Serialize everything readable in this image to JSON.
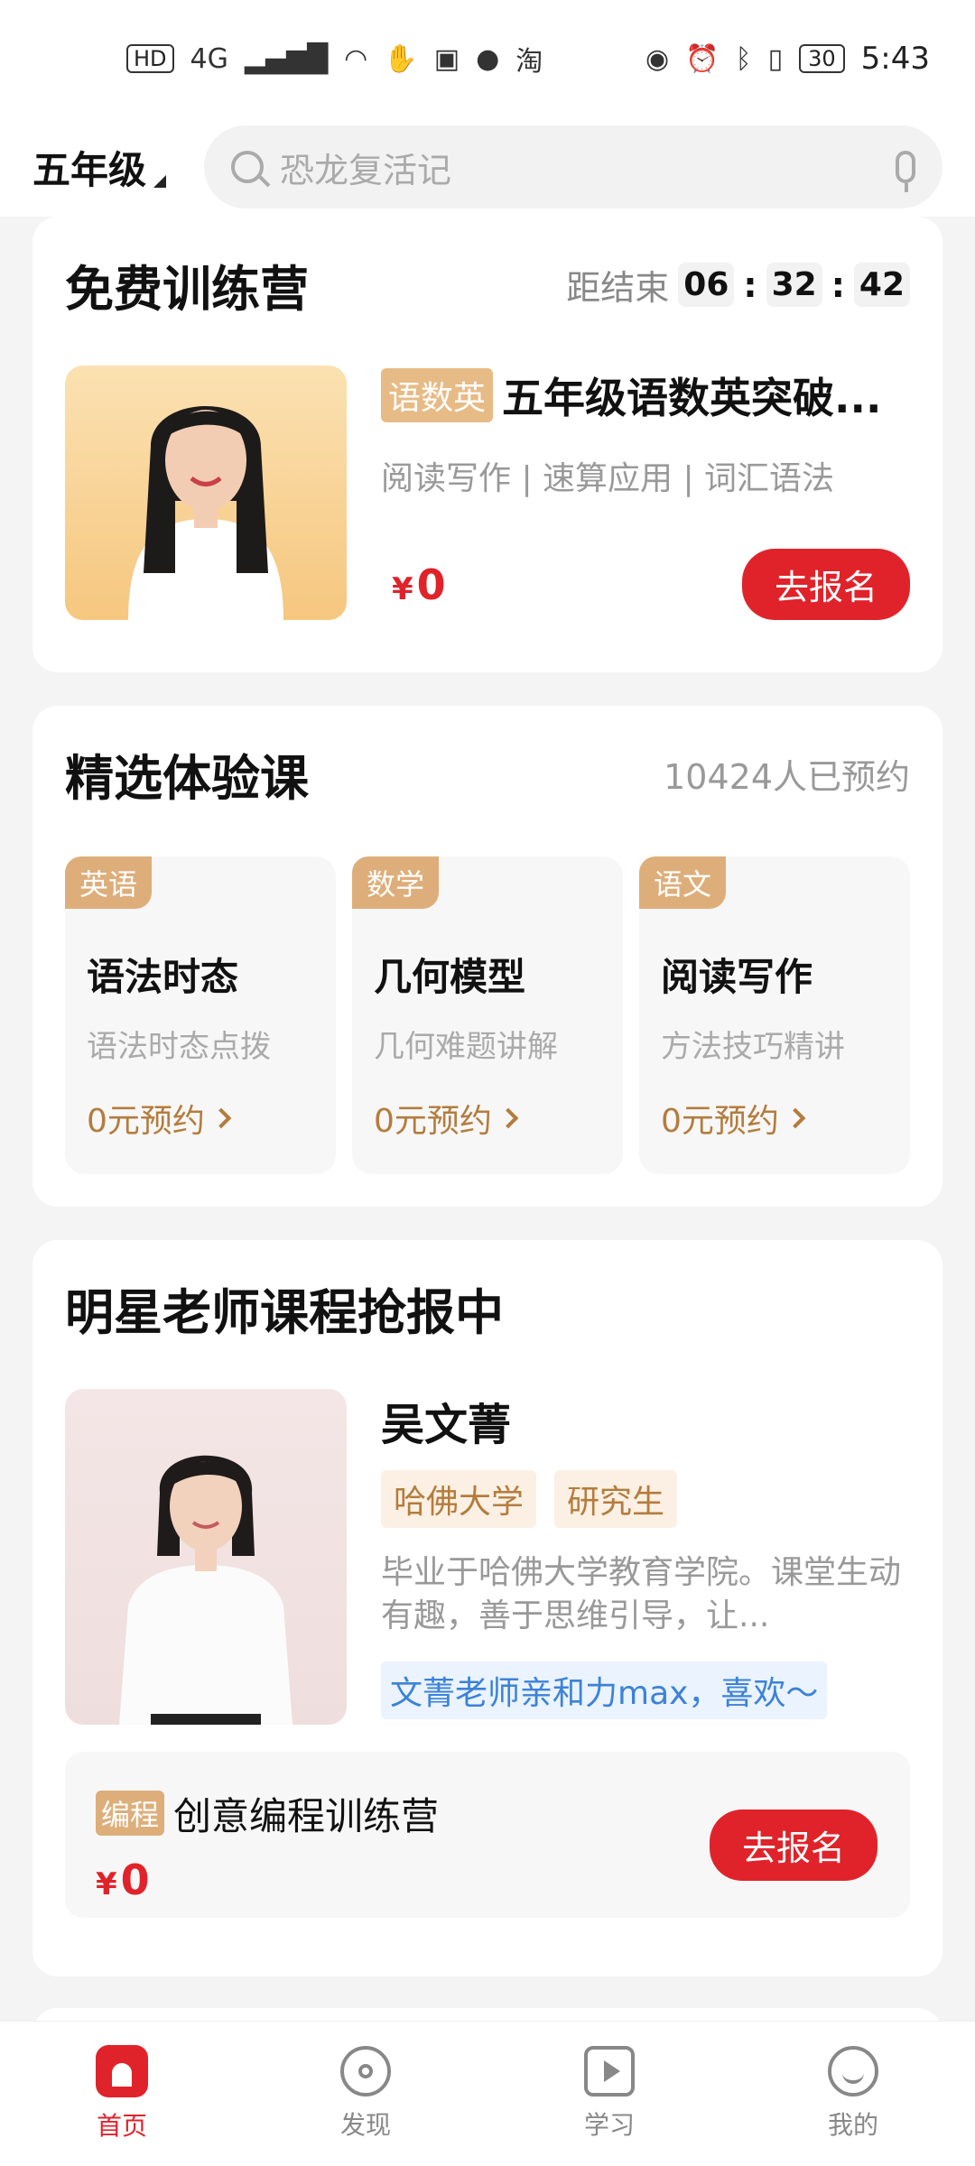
{
  "status": {
    "time": "5:43",
    "battery": "30",
    "left_icons": [
      "HD",
      "4G",
      "signal",
      "wifi",
      "hand",
      "app",
      "message",
      "淘"
    ],
    "right_icons": [
      "eye",
      "alarm",
      "bluetooth",
      "vibrate"
    ]
  },
  "header": {
    "grade": "五年级",
    "search_placeholder": "恐龙复活记"
  },
  "free_camp": {
    "title": "免费训练营",
    "countdown_label": "距结束",
    "countdown": [
      "06",
      "32",
      "42"
    ],
    "course": {
      "tag": "语数英",
      "title": "五年级语数英突破...",
      "subtitle": "阅读写作 | 速算应用 | 词汇语法",
      "price_symbol": "¥",
      "price": "0",
      "cta": "去报名"
    }
  },
  "trial": {
    "title": "精选体验课",
    "count": "10424人已预约",
    "items": [
      {
        "tag": "英语",
        "title": "语法时态",
        "subtitle": "语法时态点拨",
        "cta": "0元预约"
      },
      {
        "tag": "数学",
        "title": "几何模型",
        "subtitle": "几何难题讲解",
        "cta": "0元预约"
      },
      {
        "tag": "语文",
        "title": "阅读写作",
        "subtitle": "方法技巧精讲",
        "cta": "0元预约"
      }
    ]
  },
  "star_teacher": {
    "title": "明星老师课程抢报中",
    "name": "吴文菁",
    "tags": [
      "哈佛大学",
      "研究生"
    ],
    "description": "毕业于哈佛大学教育学院。课堂生动有趣，善于思维引导，让...",
    "quote": "文菁老师亲和力max，喜欢～",
    "course": {
      "tag": "编程",
      "title": "创意编程训练营",
      "price_symbol": "¥",
      "price": "0",
      "cta": "去报名"
    }
  },
  "tabs": [
    {
      "label": "首页",
      "icon": "home-icon",
      "active": true
    },
    {
      "label": "发现",
      "icon": "discover-icon",
      "active": false
    },
    {
      "label": "学习",
      "icon": "study-icon",
      "active": false
    },
    {
      "label": "我的",
      "icon": "mine-icon",
      "active": false
    }
  ],
  "colors": {
    "brand_red": "#e0232a",
    "gold_tag": "#deae7a",
    "link_blue": "#3c82d8"
  }
}
